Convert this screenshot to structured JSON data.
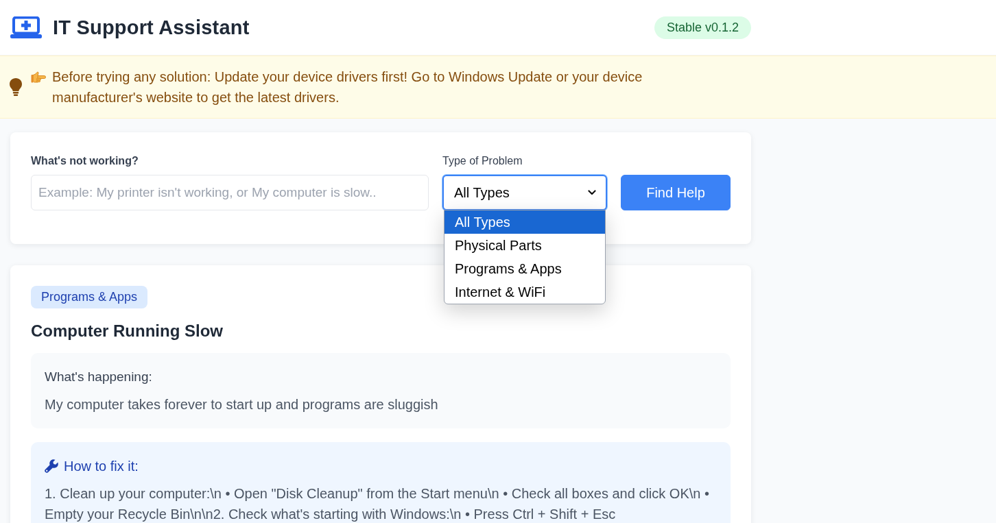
{
  "header": {
    "title": "IT Support Assistant",
    "version_badge": "Stable v0.1.2"
  },
  "notice": {
    "text": "Before trying any solution: Update your device drivers first! Go to Windows Update or your device manufacturer's website to get the latest drivers."
  },
  "search": {
    "label": "What's not working?",
    "placeholder": "Example: My printer isn't working, or My computer is slow..",
    "filter": {
      "label": "Type of Problem",
      "value": "All Types",
      "expanded": true,
      "options": [
        {
          "label": "All Types",
          "selected": true
        },
        {
          "label": "Physical Parts",
          "selected": false
        },
        {
          "label": "Programs & Apps",
          "selected": false
        },
        {
          "label": "Internet & WiFi",
          "selected": false
        }
      ]
    },
    "button": "Find Help"
  },
  "result": {
    "category": "Programs & Apps",
    "title": "Computer Running Slow",
    "symptom": {
      "heading": "What's happening:",
      "text": "My computer takes forever to start up and programs are sluggish"
    },
    "fix": {
      "heading": "How to fix it:",
      "text": "1. Clean up your computer:\\n • Open \"Disk Cleanup\" from the Start menu\\n • Check all boxes and click OK\\n • Empty your Recycle Bin\\n\\n2. Check what's starting with Windows:\\n • Press Ctrl + Shift + Esc"
    }
  }
}
